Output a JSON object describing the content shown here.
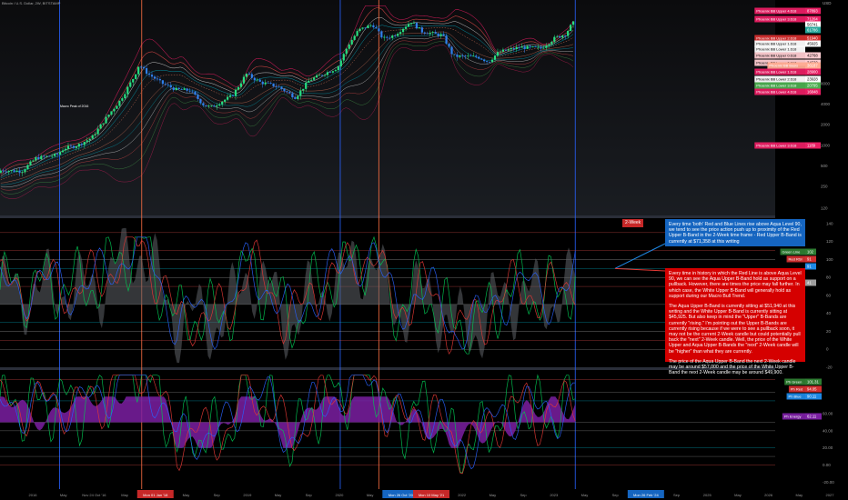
{
  "title": "Bitcoin / U.S. Dollar, 2W, BITSTAMP",
  "currency": "USD",
  "tag_2week": "2-Week",
  "annotation_blue": "Every time 'both' Red and Blue Lines rise above Aqua Level 90, we tend to see the price action push up to proximity of the Red Upper B-Band in the 2-Week time frame - Red Upper B-Band is currently at $71,358 at this writing",
  "annotation_red": [
    "Every time in history in which the Red Line is above Aqua Level 90, we can see the Aqua Upper B-Band hold as support on a pullback. However, there are times the price may fall further. In which case, the White Upper B-Band will generally hold as support during our Macro Bull Trend.",
    "The Aqua Upper B-Band is currently sitting at $51,940 at this writing and the White Upper B-Band is currently sitting at $45,925. But also keep in mind the \"Upper\" B-Bands are currently \"rising.\" I'm pointing out the Upper B-Bands are currently rising because if we were to see a pullback soon, it may not be the current 2-Week candle but could potentially pull back the \"next\" 2-Week candle. Well, the price of the White Upper and Aqua Upper B-Bands the \"next\" 2-Week candle will be \"higher\" than what they are currently.",
    "The price of the Aqua Upper B-Band the next 2-Week candle may be around $57,000 and the price of the White Upper B-Band the next 2-Week candle may be around $49,900."
  ],
  "small_label": "Macro Peak of 2016",
  "price_tags": [
    {
      "label": "Phoenix BB Upper 4.618",
      "value": "87893",
      "color": "#e91e63"
    },
    {
      "label": "Phoenix BB Upper 3.618",
      "value": "71204",
      "color": "#e91e63"
    },
    {
      "label": "",
      "value": "56741",
      "color": "#ffffff"
    },
    {
      "label": "",
      "value": "61786",
      "color": "#26a69a"
    },
    {
      "label": "Phoenix BB Upper 2.618",
      "value": "51940",
      "color": "#d32f2f"
    },
    {
      "label": "Phoenix BB Upper 1.618",
      "value": "45925",
      "color": "#ffffff"
    },
    {
      "label": "Phoenix BB Lower 1.618",
      "value": "",
      "color": "#ffffff"
    },
    {
      "label": "Phoenix BB Upper 0.618",
      "value": "42768",
      "color": "#ffcdd2"
    },
    {
      "label": "Phoenix BB Lower 0.618",
      "value": "34530",
      "color": "#ffcdd2"
    },
    {
      "label": "Phoenix BB Basis",
      "value": "36187",
      "color": "#ffab91"
    },
    {
      "label": "Phoenix BB Lower 1.618",
      "value": "28900",
      "color": "#e91e63"
    },
    {
      "label": "Phoenix BB Lower 2.618",
      "value": "23928",
      "color": "#ffffff"
    },
    {
      "label": "Phoenix BB Lower 3.618",
      "value": "20795",
      "color": "#4caf50"
    },
    {
      "label": "Phoenix BB Lower 4.618",
      "value": "16848",
      "color": "#e91e63"
    },
    {
      "label": "Phoenix BB Lower 3.618",
      "value": "1189",
      "color": "#e91e63"
    }
  ],
  "osc_tags": [
    {
      "label": "Green Line",
      "value": "102",
      "color": "#2e7d32"
    },
    {
      "label": "Red RSI",
      "value": "91",
      "color": "#d32f2f"
    },
    {
      "label": "",
      "value": "91",
      "color": "#1e88e5"
    },
    {
      "label": "Energy",
      "value": "41",
      "color": "#9e9e9e"
    }
  ],
  "phx_tags": [
    {
      "label": "Ph Green",
      "value": "101.31",
      "color": "#2e7d32"
    },
    {
      "label": "Ph Red",
      "value": "94.05",
      "color": "#d32f2f"
    },
    {
      "label": "Ph Blue",
      "value": "90.11",
      "color": "#1e88e5"
    },
    {
      "label": "Ph Energy",
      "value": "62.11",
      "color": "#7b1fa2"
    }
  ],
  "price_axis": [
    "8000",
    "4000",
    "2000",
    "1000",
    "500",
    "250",
    "120"
  ],
  "osc_axis": [
    "140",
    "120",
    "100",
    "80",
    "60",
    "40",
    "20",
    "0",
    "-20"
  ],
  "phx_axis": [
    "60.00",
    "40.00",
    "20.00",
    "0.00",
    "-20.00"
  ],
  "time_axis": [
    "2016",
    "May",
    "Nov 24 Oct '16",
    "May",
    "Mon 01 Jan '18",
    "May",
    "Sep",
    "2019",
    "May",
    "Sep",
    "2020",
    "May",
    "Mon 26 Oct '20",
    "Mon 10 May '21",
    "2022",
    "May",
    "Sep",
    "2023",
    "May",
    "Sep",
    "Mon 26 Feb '24",
    "Sep",
    "2025",
    "May",
    "2026",
    "May",
    "2027"
  ],
  "colors": {
    "bull": "#26de81",
    "bear": "#2f80ed",
    "red": "#e53935",
    "green": "#00c853",
    "blue": "#2962ff",
    "energy": "#9c27b0",
    "aqua": "#00bcd4"
  },
  "chart_data": {
    "type": "line",
    "log_scale": true,
    "price_series": {
      "name": "BTCUSD",
      "points": [
        [
          2015.8,
          280
        ],
        [
          2016.0,
          430
        ],
        [
          2016.3,
          420
        ],
        [
          2016.5,
          650
        ],
        [
          2016.8,
          720
        ],
        [
          2016.9,
          900
        ],
        [
          2017.1,
          1000
        ],
        [
          2017.3,
          1300
        ],
        [
          2017.5,
          2500
        ],
        [
          2017.7,
          4500
        ],
        [
          2017.9,
          10000
        ],
        [
          2017.97,
          15000
        ],
        [
          2018.1,
          11000
        ],
        [
          2018.3,
          8000
        ],
        [
          2018.5,
          6500
        ],
        [
          2018.7,
          6300
        ],
        [
          2018.9,
          3800
        ],
        [
          2019.0,
          3600
        ],
        [
          2019.3,
          5300
        ],
        [
          2019.5,
          11000
        ],
        [
          2019.7,
          8300
        ],
        [
          2019.95,
          7200
        ],
        [
          2020.2,
          5000
        ],
        [
          2020.4,
          9000
        ],
        [
          2020.6,
          11000
        ],
        [
          2020.8,
          13500
        ],
        [
          2020.95,
          29000
        ],
        [
          2021.1,
          48000
        ],
        [
          2021.3,
          58000
        ],
        [
          2021.45,
          36000
        ],
        [
          2021.6,
          40000
        ],
        [
          2021.85,
          64000
        ],
        [
          2022.0,
          46000
        ],
        [
          2022.3,
          40000
        ],
        [
          2022.45,
          20000
        ],
        [
          2022.8,
          19500
        ],
        [
          2022.95,
          16500
        ],
        [
          2023.1,
          23000
        ],
        [
          2023.4,
          27000
        ],
        [
          2023.7,
          26000
        ],
        [
          2023.9,
          37000
        ],
        [
          2024.05,
          42000
        ],
        [
          2024.15,
          61000
        ]
      ]
    },
    "oscillator": {
      "series": [
        {
          "name": "Red RSI",
          "last": 91
        },
        {
          "name": "Blue",
          "last": 91
        },
        {
          "name": "Green Line",
          "last": 102
        },
        {
          "name": "Energy",
          "last": 41
        }
      ],
      "levels": [
        90,
        70,
        50,
        30
      ]
    },
    "phoenix": {
      "series": [
        {
          "name": "Ph Green",
          "last": 101.31
        },
        {
          "name": "Ph Red",
          "last": 94.05
        },
        {
          "name": "Ph Blue",
          "last": 90.11
        },
        {
          "name": "Ph Energy",
          "last": 62.11
        }
      ]
    },
    "vlines": [
      {
        "x": 2016.8,
        "color": "blue"
      },
      {
        "x": 2017.97,
        "color": "orange"
      },
      {
        "x": 2020.8,
        "color": "blue"
      },
      {
        "x": 2021.35,
        "color": "orange"
      },
      {
        "x": 2024.15,
        "color": "blue"
      }
    ],
    "xlim": [
      2015.95,
      2027.0
    ]
  }
}
